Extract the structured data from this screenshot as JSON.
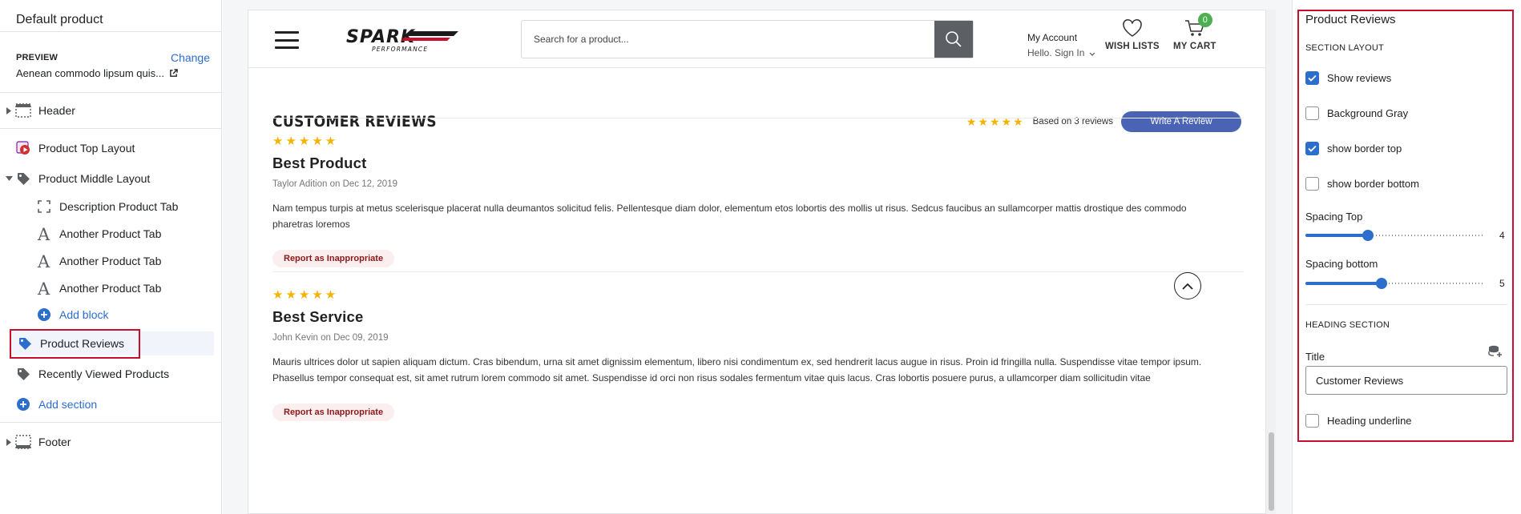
{
  "left_panel": {
    "title": "Default product",
    "preview_label": "PREVIEW",
    "change_label": "Change",
    "preview_value": "Aenean commodo lipsum quis...",
    "tree": [
      {
        "label": "Header",
        "icon": "header-section-icon"
      },
      {
        "label": "Product Top Layout",
        "icon": "product-top-layout-icon"
      },
      {
        "label": "Product Middle Layout",
        "icon": "tag-icon"
      },
      {
        "label": "Description Product Tab",
        "icon": "dashed-frame-icon"
      },
      {
        "label": "Another Product Tab",
        "icon": "text-block-icon"
      },
      {
        "label": "Another Product Tab",
        "icon": "text-block-icon"
      },
      {
        "label": "Another Product Tab",
        "icon": "text-block-icon"
      },
      {
        "label": "Add block",
        "icon": "plus-circle-icon"
      },
      {
        "label": "Product Reviews",
        "icon": "tag-icon"
      },
      {
        "label": "Recently Viewed Products",
        "icon": "tag-icon"
      },
      {
        "label": "Add section",
        "icon": "plus-circle-icon"
      },
      {
        "label": "Footer",
        "icon": "footer-section-icon"
      }
    ]
  },
  "store": {
    "search_placeholder": "Search for a product...",
    "account_title": "My Account",
    "account_sub": "Hello. Sign In",
    "wishlist_label": "WISH LISTS",
    "cart_label": "MY CART",
    "cart_count": "0",
    "reviews_title": "CUSTOMER REVIEWS",
    "summary_stars": "★★★★★",
    "summary_text": "Based on 3 reviews",
    "write_review": "Write A Review",
    "reviews": [
      {
        "stars": "★★★★★",
        "title": "Best Product",
        "meta": "Taylor Adition on Dec 12, 2019",
        "body": "Nam tempus turpis at metus scelerisque placerat nulla deumantos solicitud felis. Pellentesque diam dolor, elementum etos lobortis des mollis ut risus. Sedcus faucibus an sullamcorper mattis drostique des commodo pharetras loremos",
        "report": "Report as Inappropriate"
      },
      {
        "stars": "★★★★★",
        "title": "Best Service",
        "meta": "John Kevin on Dec 09, 2019",
        "body": "Mauris ultrices dolor ut sapien aliquam dictum. Cras bibendum, urna sit amet dignissim elementum, libero nisi condimentum ex, sed hendrerit lacus augue in risus. Proin id fringilla nulla. Suspendisse vitae tempor ipsum. Phasellus tempor consequat est, sit amet rutrum lorem commodo sit amet. Suspendisse id orci non risus sodales fermentum vitae quis lacus. Cras lobortis posuere purus, a ullamcorper diam sollicitudin vitae",
        "report": "Report as Inappropriate"
      }
    ]
  },
  "right_panel": {
    "title": "Product Reviews",
    "section_layout": "SECTION LAYOUT",
    "checkboxes": [
      {
        "label": "Show reviews",
        "checked": true
      },
      {
        "label": "Background Gray",
        "checked": false
      },
      {
        "label": "show border top",
        "checked": true
      },
      {
        "label": "show border bottom",
        "checked": false
      }
    ],
    "spacing_top_label": "Spacing Top",
    "spacing_top_value": "4",
    "spacing_top_fraction": 0.35,
    "spacing_bottom_label": "Spacing bottom",
    "spacing_bottom_value": "5",
    "spacing_bottom_fraction": 0.43,
    "heading_section": "HEADING SECTION",
    "title_field_label": "Title",
    "title_field_value": "Customer Reviews",
    "heading_underline_label": "Heading underline",
    "heading_underline_checked": false
  },
  "colors": {
    "accent": "#2c6ecb",
    "highlight_border": "#c8102e",
    "star": "#f5b301",
    "write_button": "#4a63b4",
    "cart_badge": "#4caf50"
  }
}
